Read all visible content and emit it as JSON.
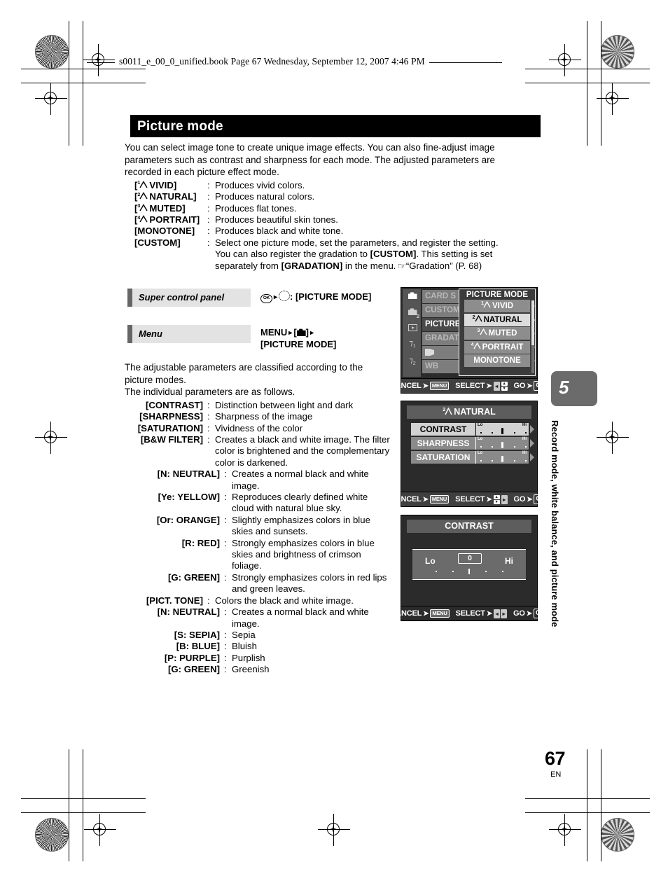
{
  "header": {
    "file_line": "s0011_e_00_0_unified.book  Page 67  Wednesday, September 12, 2007  4:46 PM"
  },
  "title": "Picture mode",
  "intro": "You can select image tone to create unique image effects. You can also fine-adjust image parameters such as contrast and sharpness for each mode. The adjusted parameters are recorded in each picture effect mode.",
  "mode_list": [
    {
      "num": "1",
      "label": "VIVID",
      "desc": "Produces vivid colors."
    },
    {
      "num": "2",
      "label": "NATURAL",
      "desc": "Produces natural colors."
    },
    {
      "num": "3",
      "label": "MUTED",
      "desc": "Produces flat tones."
    },
    {
      "num": "4",
      "label": "PORTRAIT",
      "desc": "Produces beautiful skin tones."
    },
    {
      "num": "",
      "label": "MONOTONE",
      "desc": "Produces black and white tone."
    }
  ],
  "custom": {
    "term": "[CUSTOM]",
    "line1": "Select one picture mode, set the parameters, and register the setting.",
    "line2_a": "You can also register the gradation to ",
    "line2_b": "[CUSTOM]",
    "line2_c": ". This setting is set",
    "line3_a": "separately from ",
    "line3_b": "[GRADATION]",
    "line3_c": " in the menu. ",
    "line3_ref": "“Gradation” (P. 68)"
  },
  "op_super": {
    "label": "Super control panel",
    "value": ": [PICTURE MODE]"
  },
  "op_menu": {
    "label": "Menu",
    "value_line1_pre": "MENU",
    "value_line1_post": "]",
    "value_line2": "[PICTURE MODE]"
  },
  "mid_para_1": "The adjustable parameters are classified according to the picture modes.",
  "mid_para_2": "The individual parameters are as follows.",
  "param_list": [
    {
      "indent": 0,
      "term": "[CONTRAST]",
      "desc": "Distinction between light and dark"
    },
    {
      "indent": 0,
      "term": "[SHARPNESS]",
      "desc": "Sharpness of the image"
    },
    {
      "indent": 0,
      "term": "[SATURATION]",
      "desc": "Vividness of the color"
    },
    {
      "indent": 0,
      "term": "[B&W FILTER]",
      "desc": "Creates a black and white image. The filter color is brightened and the complementary color is darkened."
    },
    {
      "indent": 1,
      "term": "[N: NEUTRAL]",
      "desc": "Creates a normal black and white image."
    },
    {
      "indent": 1,
      "term": "[Ye: YELLOW]",
      "desc": "Reproduces clearly defined white cloud with natural blue sky."
    },
    {
      "indent": 1,
      "term": "[Or: ORANGE]",
      "desc": "Slightly emphasizes colors in blue skies and sunsets."
    },
    {
      "indent": 1,
      "term": "[R: RED]",
      "desc": "Strongly emphasizes colors in blue skies and brightness of crimson foliage."
    },
    {
      "indent": 1,
      "term": "[G: GREEN]",
      "desc": "Strongly emphasizes colors in red lips and green leaves."
    },
    {
      "indent": 0,
      "term": "[PICT. TONE]",
      "desc": "Colors the black and white image."
    },
    {
      "indent": 1,
      "term": "[N: NEUTRAL]",
      "desc": "Creates a normal black and white image."
    },
    {
      "indent": 1,
      "term": "[S: SEPIA]",
      "desc": "Sepia"
    },
    {
      "indent": 1,
      "term": "[B: BLUE]",
      "desc": "Bluish"
    },
    {
      "indent": 1,
      "term": "[P: PURPLE]",
      "desc": "Purplish"
    },
    {
      "indent": 1,
      "term": "[G: GREEN]",
      "desc": "Greenish"
    }
  ],
  "screen1": {
    "sidebar_icons": [
      "camera-1-icon",
      "camera-2-icon",
      "playback-icon",
      "wrench-1-icon",
      "wrench-2-icon"
    ],
    "sidebar_labels": [
      "1",
      "2",
      "",
      "1",
      "2"
    ],
    "menu_items": [
      "CARD S",
      "CUSTOM",
      "PICTURE",
      "GRADAT",
      "",
      "WB"
    ],
    "menu_selected_index": 2,
    "popup_title": "PICTURE MODE",
    "popup_items": [
      {
        "num": "1",
        "label": "VIVID"
      },
      {
        "num": "2",
        "label": "NATURAL"
      },
      {
        "num": "3",
        "label": "MUTED"
      },
      {
        "num": "4",
        "label": "PORTRAIT"
      },
      {
        "num": "",
        "label": "MONOTONE"
      }
    ],
    "popup_selected_index": 1,
    "foot": {
      "cancel": "CANCEL",
      "menu_key": "MENU",
      "select": "SELECT",
      "go": "GO",
      "ok": "OK"
    }
  },
  "screen2": {
    "title_num": "2",
    "title": "NATURAL",
    "rows": [
      {
        "name": "CONTRAST",
        "lo": "Lo",
        "hi": "Hi",
        "value": 0
      },
      {
        "name": "SHARPNESS",
        "lo": "Lo",
        "hi": "Hi",
        "value": 0
      },
      {
        "name": "SATURATION",
        "lo": "Lo",
        "hi": "Hi",
        "value": 0
      }
    ],
    "selected_index": 0,
    "foot": {
      "cancel": "CANCEL",
      "menu_key": "MENU",
      "select": "SELECT",
      "go": "GO",
      "ok": "OK"
    }
  },
  "screen3": {
    "title": "CONTRAST",
    "lo": "Lo",
    "hi": "Hi",
    "value": "0",
    "foot": {
      "cancel": "CANCEL",
      "menu_key": "MENU",
      "select": "SELECT",
      "go": "GO",
      "ok": "OK"
    }
  },
  "chapter": {
    "number": "5",
    "vertical_title": "Record mode, white balance, and picture mode"
  },
  "page": {
    "number": "67",
    "lang": "EN"
  },
  "colors": {
    "title_bar": "#000000",
    "op_label_bg": "#e3e3e3",
    "op_label_bar": "#666666",
    "chapter_tab": "#6b6b6b"
  }
}
